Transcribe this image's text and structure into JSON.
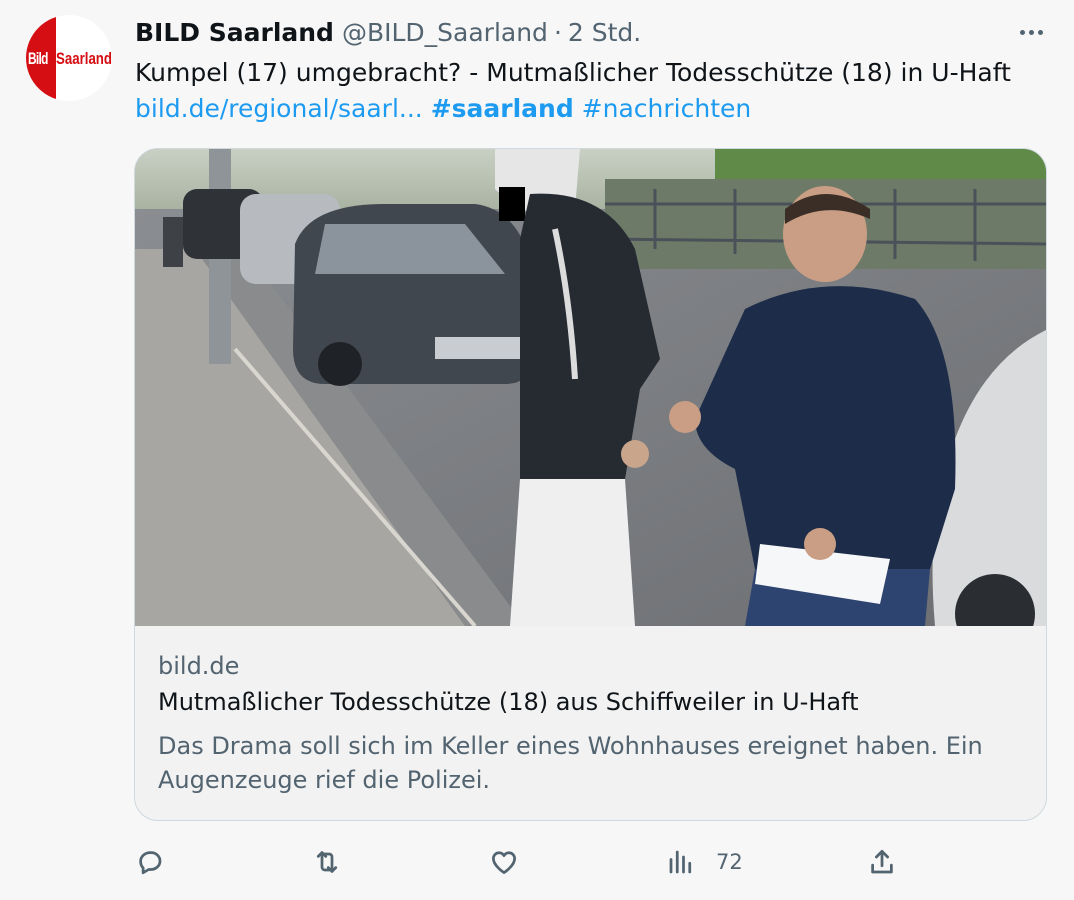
{
  "tweet": {
    "author": {
      "name": "BILD Saarland",
      "handle": "@BILD_Saarland",
      "logo_left": "Bild",
      "logo_right": "Saarland"
    },
    "separator": "·",
    "time": "2 Std.",
    "text": "Kumpel (17) umgebracht? - Mutmaßlicher Todesschütze (18) in U-Haft",
    "link": "bild.de/regional/saarl...",
    "hashtag_bold": "#saarland",
    "hashtag": "#nachrichten"
  },
  "card": {
    "domain": "bild.de",
    "title": "Mutmaßlicher Todesschütze (18) aus Schiffweiler in U-Haft",
    "description": "Das Drama soll sich im Keller eines Wohnhauses ereignet haben. Ein Augenzeuge rief die Polizei."
  },
  "actions": {
    "reply_icon": "reply-icon",
    "retweet_icon": "retweet-icon",
    "like_icon": "heart-icon",
    "views_icon": "views-icon",
    "views_count": "72",
    "share_icon": "share-icon"
  },
  "colors": {
    "link": "#1d9bf0",
    "brand_red": "#d40e13",
    "muted": "#536471"
  }
}
